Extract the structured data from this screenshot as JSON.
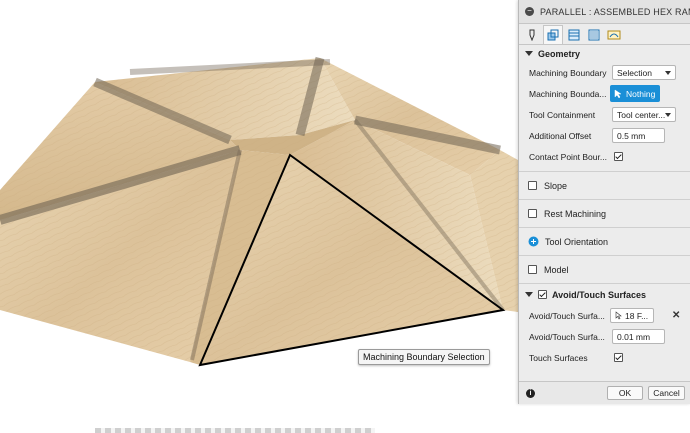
{
  "window": {
    "title": "PARALLEL : ASSEMBLED HEX RAMP FINISH"
  },
  "tooltip": "Machining Boundary Selection",
  "tabs": [
    {
      "name": "tool",
      "icon": "tool-icon"
    },
    {
      "name": "geometry",
      "icon": "geometry-icon"
    },
    {
      "name": "heights",
      "icon": "heights-icon"
    },
    {
      "name": "passes",
      "icon": "passes-icon"
    },
    {
      "name": "linking",
      "icon": "linking-icon"
    }
  ],
  "geometry": {
    "header": "Geometry",
    "machining_boundary": {
      "label": "Machining Boundary",
      "value": "Selection"
    },
    "boundary_selection": {
      "label": "Machining Bounda...",
      "value": "Nothing"
    },
    "tool_containment": {
      "label": "Tool Containment",
      "value": "Tool center..."
    },
    "additional_offset": {
      "label": "Additional Offset",
      "value": "0.5 mm"
    },
    "contact_point": {
      "label": "Contact Point Bour...",
      "checked": true
    }
  },
  "sections": {
    "slope": "Slope",
    "rest_machining": "Rest Machining",
    "tool_orientation": "Tool Orientation",
    "model": "Model"
  },
  "avoid": {
    "header": "Avoid/Touch Surfaces",
    "checked": true,
    "surfaces": {
      "label": "Avoid/Touch Surfa...",
      "value": "18 F..."
    },
    "clearance": {
      "label": "Avoid/Touch Surfa...",
      "value": "0.01 mm"
    },
    "touch": {
      "label": "Touch Surfaces",
      "checked": true
    }
  },
  "footer": {
    "ok": "OK",
    "cancel": "Cancel"
  },
  "colors": {
    "accent": "#1a8fd7",
    "wood": "#ddc49e",
    "selection_outline": "#000000"
  }
}
